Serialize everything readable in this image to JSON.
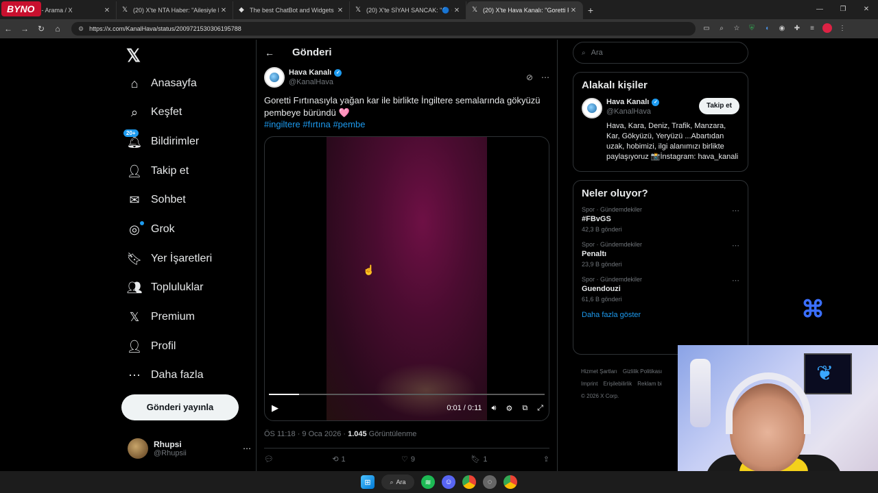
{
  "browser": {
    "logo_text": "BYNO",
    "tabs": [
      {
        "title": "#FBvGS - Arama / X",
        "icon": "x-icon",
        "active": false
      },
      {
        "title": "(20) X'te NTA Haber: \"Ailesiyle b",
        "icon": "x-icon",
        "active": false
      },
      {
        "title": "The best ChatBot and Widgets",
        "icon": "diamond-icon",
        "active": false
      },
      {
        "title": "(20) X'te SİYAH SANCAK: \"🔵 ⚫",
        "icon": "x-icon",
        "active": false
      },
      {
        "title": "(20) X'te Hava Kanalı: \"Goretti F",
        "icon": "x-icon",
        "active": true
      }
    ],
    "new_tab": "+",
    "url": "https://x.com/KanalHava/status/2009721530306195788"
  },
  "nav": {
    "items": [
      {
        "label": "Anasayfa",
        "icon": "⌂"
      },
      {
        "label": "Keşfet",
        "icon": "⌕"
      },
      {
        "label": "Bildirimler",
        "icon": "🔔︎",
        "badge": "20+"
      },
      {
        "label": "Takip et",
        "icon": "👤︎"
      },
      {
        "label": "Sohbet",
        "icon": "✉"
      },
      {
        "label": "Grok",
        "icon": "◎"
      },
      {
        "label": "Yer İşaretleri",
        "icon": "🔖︎"
      },
      {
        "label": "Topluluklar",
        "icon": "👥︎"
      },
      {
        "label": "Premium",
        "icon": "𝕏"
      },
      {
        "label": "Profil",
        "icon": "👤︎"
      },
      {
        "label": "Daha fazla",
        "icon": "⋯"
      }
    ],
    "post_button": "Gönderi yayınla",
    "profile": {
      "name": "Rhupsi",
      "handle": "@Rhupsii"
    }
  },
  "tweet": {
    "header_title": "Gönderi",
    "author_name": "Hava Kanalı",
    "author_handle": "@KanalHava",
    "text": "Goretti Fırtınasıyla yağan kar ile birlikte  İngiltere semalarında gökyüzü pembeye büründü",
    "emoji": "🩷",
    "hashtags": "#ingiltere #fırtına #pembe",
    "video": {
      "time": "0:01 / 0:11",
      "progress": 0.11
    },
    "timestamp": "ÖS 11:18 · 9 Oca 2026 · ",
    "views_count": "1.045",
    "views_label": " Görüntülenme",
    "stats": {
      "replies": "",
      "reposts": "1",
      "likes": "9",
      "bookmarks": "1"
    }
  },
  "sidebar": {
    "search_placeholder": "Ara",
    "related_title": "Alakalı kişiler",
    "related": {
      "name": "Hava Kanalı",
      "handle": "@KanalHava",
      "follow_label": "Takip et",
      "bio": "Hava, Kara, Deniz, Trafik, Manzara, Kar, Gökyüzü, Yeryüzü ...Abartıdan uzak, hobimizi, ilgi alanımızı birlikte paylaşıyoruz 📸İnstagram: hava_kanali"
    },
    "trends_title": "Neler oluyor?",
    "trends": [
      {
        "category": "Spor · Gündemdekiler",
        "name": "#FBvGS",
        "count": "42,3 B gönderi"
      },
      {
        "category": "Spor · Gündemdekiler",
        "name": "Penaltı",
        "count": "23,9 B gönderi"
      },
      {
        "category": "Spor · Gündemdekiler",
        "name": "Guendouzi",
        "count": "61,6 B gönderi"
      }
    ],
    "show_more": "Daha fazla göster",
    "footer": [
      "Hizmet Şartları",
      "Gizlilik Politikası",
      "Imprint",
      "Erişilebilirlik",
      "Reklam bi",
      "© 2026 X Corp."
    ]
  },
  "taskbar": {
    "search_label": "Ara"
  }
}
